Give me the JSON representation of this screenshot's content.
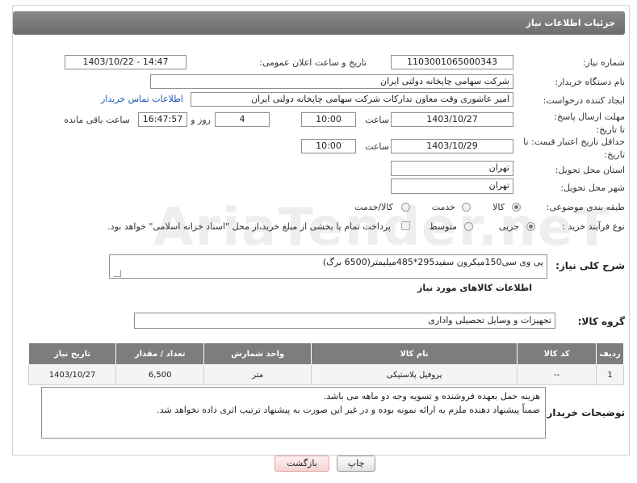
{
  "header": {
    "title": "جزئیات اطلاعات نیاز"
  },
  "watermark": "AriaTender.neT",
  "form": {
    "need_number_label": "شماره نیاز:",
    "need_number": "1103001065000343",
    "announce_label": "تاریخ و ساعت اعلان عمومی:",
    "announce_value": "1403/10/22 - 14:47",
    "buyer_org_label": "نام دستگاه خریدار:",
    "buyer_org": "شرکت سهامی چاپخانه دولتی ایران",
    "creator_label": "ایجاد کننده درخواست:",
    "creator": "امیر عاشوری وقت معاون تدارکات شرکت سهامی چاپخانه دولتی ایران",
    "contact_link": "اطلاعات تماس خریدار",
    "reply_deadline_label": "مهلت ارسال پاسخ: تا تاریخ:",
    "reply_date": "1403/10/27",
    "time_label": "ساعت",
    "reply_time": "10:00",
    "days_count": "4",
    "days_label": "روز و",
    "remaining_time": "16:47:57",
    "remaining_label": "ساعت باقی مانده",
    "price_valid_label": "حداقل تاریخ اعتبار قیمت: تا تاریخ:",
    "price_valid_date": "1403/10/29",
    "price_valid_time": "10:00",
    "province_label": "استان محل تحویل:",
    "province": "تهران",
    "city_label": "شهر محل تحویل:",
    "city": "تهران",
    "category_label": "طبقه بندی موضوعی:",
    "category_options": [
      "کالا",
      "خدمت",
      "کالا/خدمت"
    ],
    "process_label": "نوع فرآیند خرید :",
    "process_options": [
      "جزیی",
      "متوسط"
    ],
    "payment_note": "پرداخت تمام یا بخشی از مبلغ خرید،از محل \"اسناد خزانه اسلامی\" خواهد بود."
  },
  "description": {
    "label": "شرح کلی نیاز:",
    "value": "پی وی سی150میکرون سفید295*485میلیمتر(6500 برگ)"
  },
  "goods": {
    "section_title": "اطلاعات کالاهای مورد نیاز",
    "group_label": "گروه کالا:",
    "group_value": "تجهیزات و وسایل تحصیلی واداری",
    "columns": [
      "ردیف",
      "کد کالا",
      "نام کالا",
      "واحد شمارش",
      "تعداد / مقدار",
      "تاریخ نیاز"
    ],
    "rows": [
      [
        "1",
        "--",
        "پروفیل پلاستیکی",
        "متر",
        "6,500",
        "1403/10/27"
      ]
    ]
  },
  "buyer_notes": {
    "label": "توضیحات خریدار:",
    "lines": [
      "هزینه حمل بعهده فروشنده و تسویه وجه دو ماهه می باشد.",
      "ضمناً پیشنهاد دهنده ملزم به ارائه نمونه بوده و در غیر این صورت به پیشنهاد ترتیب اثری داده نخواهد شد."
    ]
  },
  "buttons": {
    "print": "چاپ",
    "back": "بازگشت"
  }
}
